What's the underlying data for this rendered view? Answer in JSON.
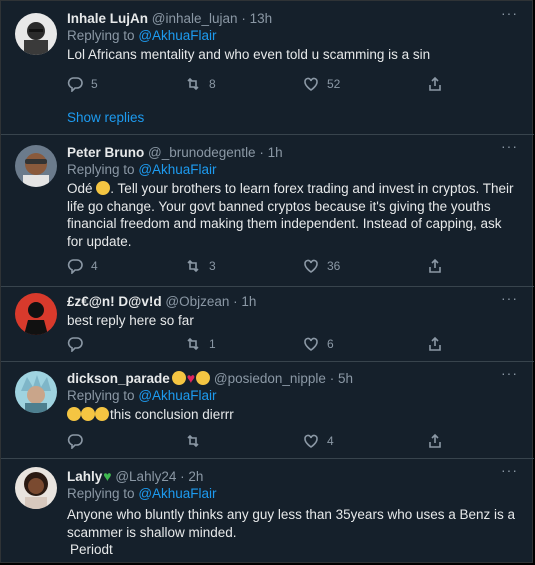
{
  "tweets": [
    {
      "name": "Inhale LujAn",
      "handle": "@inhale_lujan",
      "time": "13h",
      "replying_prefix": "Replying to",
      "replying_to": "@AkhuaFlair",
      "text": "Lol Africans mentality and who even told u scamming is a sin",
      "replies": "5",
      "retweets": "8",
      "likes": "52",
      "show_replies": "Show replies"
    },
    {
      "name": "Peter Bruno",
      "handle": "@_brunodegentle",
      "time": "1h",
      "replying_prefix": "Replying to",
      "replying_to": "@AkhuaFlair",
      "text_before_emoji": "Odé",
      "text_after_emoji": ". Tell your brothers to learn forex trading and invest in cryptos. Their life go change. Your govt banned cryptos because it's giving the youths financial freedom and making them independent. Instead of capping, ask for update.",
      "replies": "4",
      "retweets": "3",
      "likes": "36"
    },
    {
      "name": "£z€@n! D@v!d",
      "handle": "@Objzean",
      "time": "1h",
      "text": "best reply here so far",
      "replies": "",
      "retweets": "1",
      "likes": "6"
    },
    {
      "name": "dickson_parade",
      "handle": "@posiedon_nipple",
      "time": "5h",
      "replying_prefix": "Replying to",
      "replying_to": "@AkhuaFlair",
      "text": "this conclusion dierrr",
      "replies": "",
      "retweets": "",
      "likes": "4"
    },
    {
      "name": "Lahly",
      "handle": "@Lahly24",
      "time": "2h",
      "replying_prefix": "Replying to",
      "replying_to": "@AkhuaFlair",
      "text_line1": "Anyone who bluntly thinks any guy less than 35years who uses a Benz is a scammer is shallow minded.",
      "text_line2": "Periodt"
    }
  ],
  "ui": {
    "more_label": "···",
    "separator": "·"
  },
  "colors": {
    "background": "#15202b",
    "link": "#1d9bf0",
    "muted": "#8b98a5",
    "text": "#e7e9ea"
  },
  "icons": [
    "reply-icon",
    "retweet-icon",
    "like-icon",
    "share-icon",
    "more-icon"
  ]
}
